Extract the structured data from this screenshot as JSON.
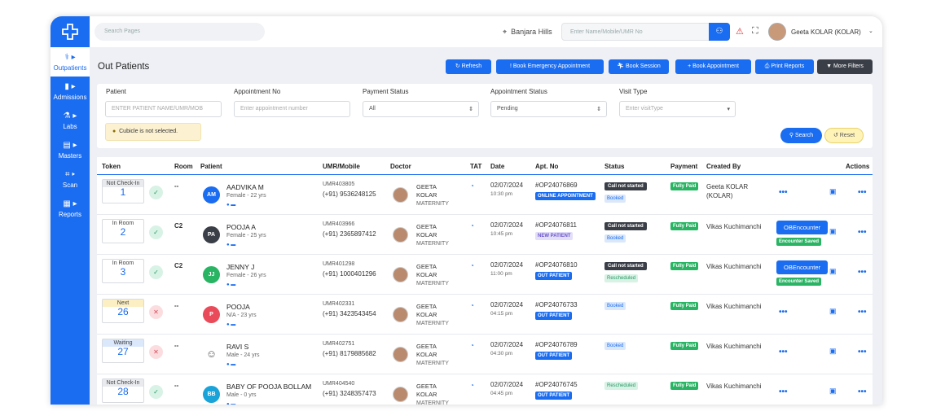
{
  "sidebar": {
    "items": [
      {
        "label": "Outpatients",
        "icon": "stethoscope-icon"
      },
      {
        "label": "Admissions",
        "icon": "bed-icon"
      },
      {
        "label": "Labs",
        "icon": "flask-icon"
      },
      {
        "label": "Masters",
        "icon": "folder-icon"
      },
      {
        "label": "Scan",
        "icon": "scan-icon"
      },
      {
        "label": "Reports",
        "icon": "report-icon"
      }
    ]
  },
  "topbar": {
    "search_placeholder": "Search Pages",
    "location": "Banjara Hills",
    "patient_search_placeholder": "Enter Name/Mobile/UMR No",
    "user": "Geeta KOLAR (KOLAR)"
  },
  "page": {
    "title": "Out Patients",
    "buttons": [
      "Refresh",
      "Book Emergency Appointment",
      "Book Session",
      "Book Appointment",
      "Print Reports",
      "More Filters"
    ]
  },
  "filters": {
    "patient_label": "Patient",
    "patient_placeholder": "ENTER PATIENT NAME/UMR/MOB",
    "apt_label": "Appointment No",
    "apt_placeholder": "Enter appointment number",
    "pay_label": "Payment Status",
    "pay_value": "All",
    "aptstatus_label": "Appointment Status",
    "aptstatus_value": "Pending",
    "visit_label": "Visit Type",
    "visit_placeholder": "Enter visitType",
    "warning": "Cubicle is not selected.",
    "search": "Search",
    "reset": "Reset"
  },
  "table": {
    "headers": [
      "Token",
      "Room",
      "Patient",
      "UMR/Mobile",
      "Doctor",
      "TAT",
      "Date",
      "Apt. No",
      "Status",
      "Payment",
      "Created By",
      "Actions"
    ],
    "rows": [
      {
        "token_label": "Not Check-In",
        "token_no": "1",
        "room": "--",
        "initials": "AM",
        "name": "AADVIKA M",
        "sub": "Female - 22 yrs",
        "umr": "UMR403805",
        "mobile": "(+91) 9536248125",
        "doctor": "GEETA KOLAR",
        "dept": "MATERNITY",
        "date": "02/07/2024",
        "time": "10:30 pm",
        "apt": "#OP24076869",
        "apt_tag": "ONLINE APPOINTMENT",
        "status1": "Call not started",
        "status2": "Booked",
        "payment": "Fully Paid",
        "created_by": "Geeta KOLAR (KOLAR)"
      },
      {
        "token_label": "In Room",
        "token_no": "2",
        "room": "C2",
        "initials": "PA",
        "name": "POOJA A",
        "sub": "Female - 25 yrs",
        "umr": "UMR403966",
        "mobile": "(+91) 2365897412",
        "doctor": "GEETA KOLAR",
        "dept": "MATERNITY",
        "date": "02/07/2024",
        "time": "10:45 pm",
        "apt": "#OP24076811",
        "apt_tag": "NEW PATIENT",
        "status1": "Call not started",
        "status2": "Booked",
        "payment": "Fully Paid",
        "created_by": "Vikas Kuchimanchi",
        "obe": "OBEncounter",
        "enc": "Encounter Saved"
      },
      {
        "token_label": "In Room",
        "token_no": "3",
        "room": "C2",
        "initials": "JJ",
        "name": "JENNY J",
        "sub": "Female - 26 yrs",
        "umr": "UMR401298",
        "mobile": "(+91) 1000401296",
        "doctor": "GEETA KOLAR",
        "dept": "MATERNITY",
        "date": "02/07/2024",
        "time": "11:00 pm",
        "apt": "#OP24076810",
        "apt_tag": "OUT PATIENT",
        "status1": "Call not started",
        "status2": "Rescheduled",
        "payment": "Fully Paid",
        "created_by": "Vikas Kuchimanchi",
        "obe": "OBEncounter",
        "enc": "Encounter Saved"
      },
      {
        "token_label": "Next",
        "token_no": "26",
        "room": "--",
        "initials": "P",
        "name": "POOJA",
        "sub": "N/A - 23 yrs",
        "umr": "UMR402331",
        "mobile": "(+91) 3423543454",
        "doctor": "GEETA KOLAR",
        "dept": "MATERNITY",
        "date": "02/07/2024",
        "time": "04:15 pm",
        "apt": "#OP24076733",
        "apt_tag": "OUT PATIENT",
        "status2": "Booked",
        "payment": "Fully Paid",
        "created_by": "Vikas Kuchimanchi"
      },
      {
        "token_label": "Waiting",
        "token_no": "27",
        "room": "--",
        "initials": "RS",
        "name": "RAVI S",
        "sub": "Male - 24 yrs",
        "umr": "UMR402751",
        "mobile": "(+91) 8179885682",
        "doctor": "GEETA KOLAR",
        "dept": "MATERNITY",
        "date": "02/07/2024",
        "time": "04:30 pm",
        "apt": "#OP24076789",
        "apt_tag": "OUT PATIENT",
        "status2": "Booked",
        "payment": "Fully Paid",
        "created_by": "Vikas Kuchimanchi"
      },
      {
        "token_label": "Not Check-In",
        "token_no": "28",
        "room": "--",
        "initials": "BB",
        "name": "BABY OF POOJA BOLLAM",
        "sub": "Male - 0 yrs",
        "umr": "UMR404540",
        "mobile": "(+91) 3248357473",
        "doctor": "GEETA KOLAR",
        "dept": "MATERNITY",
        "date": "02/07/2024",
        "time": "04:45 pm",
        "apt": "#OP24076745",
        "apt_tag": "OUT PATIENT",
        "status2": "Rescheduled",
        "payment": "Fully Paid",
        "created_by": "Vikas Kuchimanchi"
      }
    ]
  }
}
